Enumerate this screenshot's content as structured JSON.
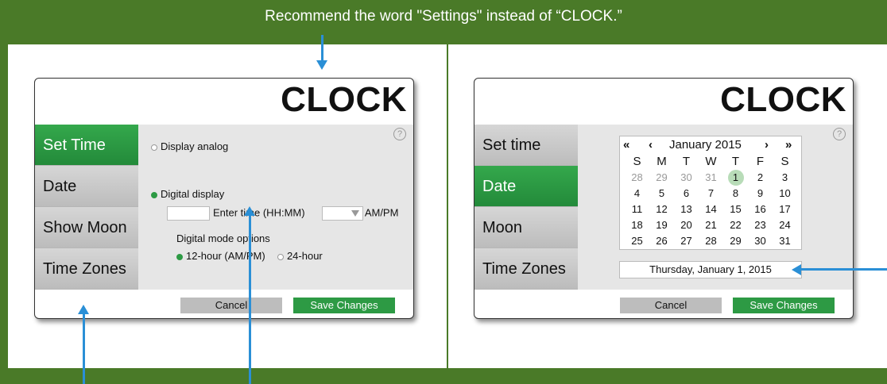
{
  "banner": {
    "text": "Recommend the word \"Settings\" instead of “CLOCK.”"
  },
  "colors": {
    "background": "#4a7a28",
    "accent": "#2d9a44",
    "arrow": "#2a8fd6"
  },
  "left_dialog": {
    "title": "CLOCK",
    "help": "?",
    "sidebar": [
      "Set Time",
      "Date",
      "Show Moon",
      "Time Zones"
    ],
    "active_index": 0,
    "display_analog": "Display analog",
    "digital_display": "Digital display",
    "enter_time": "Enter time (HH:MM)",
    "ampm": "AM/PM",
    "mode_label": "Digital mode options",
    "opt_12": "12-hour (AM/PM)",
    "opt_24": "24-hour",
    "cancel": "Cancel",
    "save": "Save Changes"
  },
  "right_dialog": {
    "title": "CLOCK",
    "help": "?",
    "sidebar": [
      "Set time",
      "Date",
      "Moon",
      "Time Zones"
    ],
    "active_index": 1,
    "calendar": {
      "nav_first": "«",
      "nav_prev": "‹",
      "month": "January 2015",
      "nav_next": "›",
      "nav_last": "»",
      "weekdays": [
        "S",
        "M",
        "T",
        "W",
        "T",
        "F",
        "S"
      ],
      "weeks": [
        [
          "28",
          "29",
          "30",
          "31",
          "1",
          "2",
          "3"
        ],
        [
          "4",
          "5",
          "6",
          "7",
          "8",
          "9",
          "10"
        ],
        [
          "11",
          "12",
          "13",
          "14",
          "15",
          "16",
          "17"
        ],
        [
          "18",
          "19",
          "20",
          "21",
          "22",
          "23",
          "24"
        ],
        [
          "25",
          "26",
          "27",
          "28",
          "29",
          "30",
          "31"
        ]
      ]
    },
    "selected_date_text": "Thursday, January 1, 2015",
    "cancel": "Cancel",
    "save": "Save Changes"
  }
}
